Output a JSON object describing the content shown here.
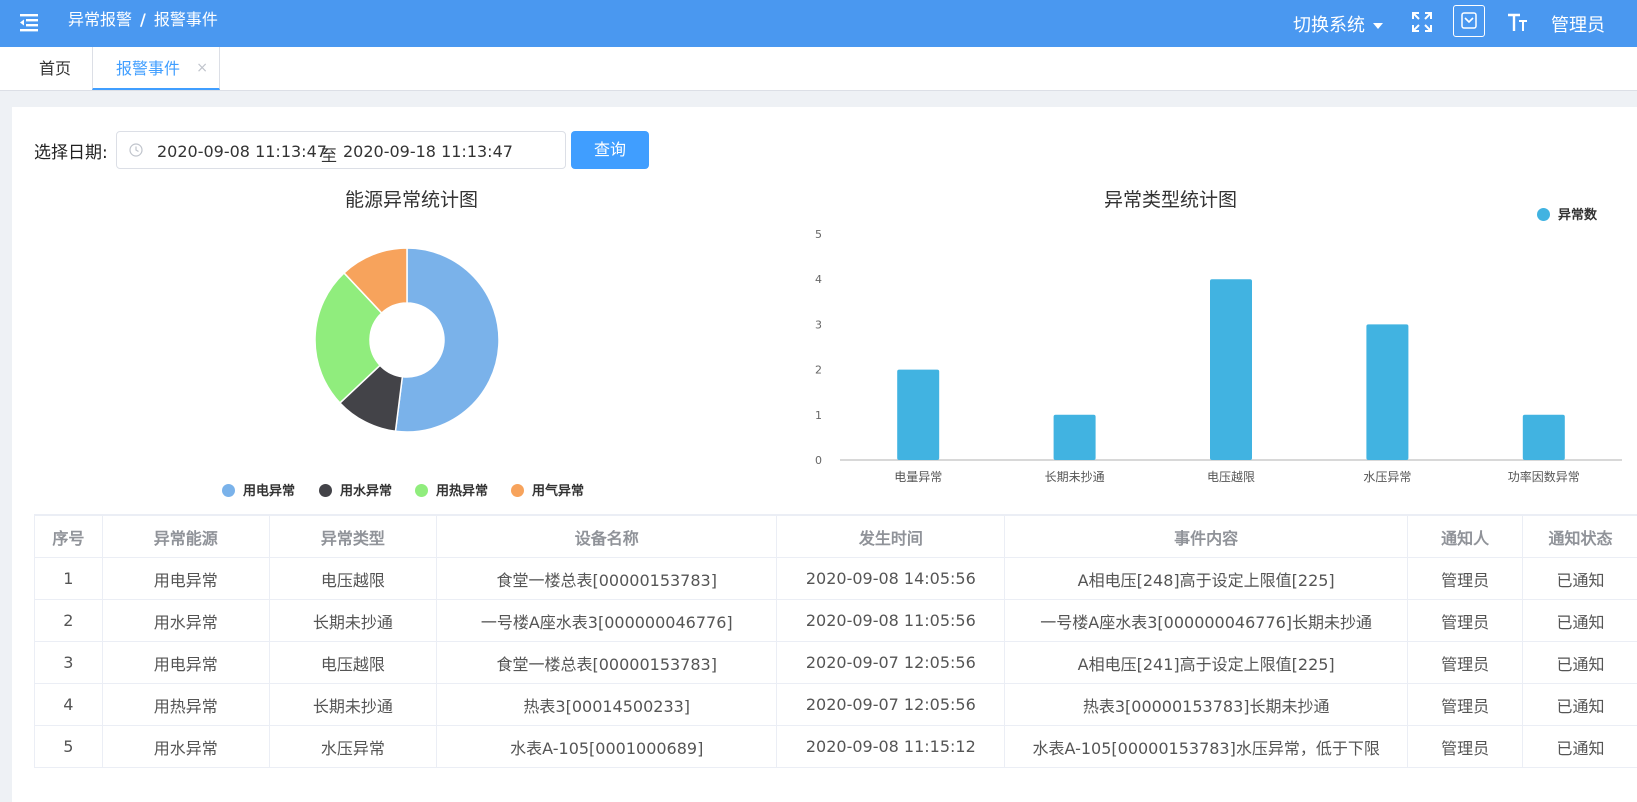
{
  "header": {
    "breadcrumb": [
      "异常报警",
      "报警事件"
    ],
    "breadcrumb_sep": "/",
    "system_switch": "切换系统",
    "user": "管理员"
  },
  "tabs": [
    {
      "label": "首页",
      "active": false
    },
    {
      "label": "报警事件",
      "active": true
    }
  ],
  "filter": {
    "date_label": "选择日期:",
    "start": "2020-09-08 11:13:47",
    "to": "至",
    "end": "2020-09-18 11:13:47",
    "query_label": "查询"
  },
  "chart_data": [
    {
      "type": "pie",
      "title": "能源异常统计图",
      "labels": [
        "用电异常",
        "用水异常",
        "用热异常",
        "用气异常"
      ],
      "values": [
        52,
        11,
        25,
        12
      ],
      "colors": [
        "#7ab2ea",
        "#434348",
        "#90ed7d",
        "#f7a35c"
      ]
    },
    {
      "type": "bar",
      "title": "异常类型统计图",
      "categories": [
        "电量异常",
        "长期未抄通",
        "电压越限",
        "水压异常",
        "功率因数异常"
      ],
      "series": [
        {
          "name": "异常数",
          "values": [
            2,
            1,
            4,
            3,
            1
          ],
          "color": "#41b3e1"
        }
      ],
      "ylim": [
        0,
        5
      ],
      "yticks": [
        "0",
        "1",
        "2",
        "3",
        "4",
        "5"
      ],
      "legend": "top-right"
    }
  ],
  "table": {
    "columns": [
      "序号",
      "异常能源",
      "异常类型",
      "设备名称",
      "发生时间",
      "事件内容",
      "通知人",
      "通知状态"
    ],
    "rows": [
      [
        "1",
        "用电异常",
        "电压越限",
        "食堂一楼总表[00000153783]",
        "2020-09-08 14:05:56",
        "A相电压[248]高于设定上限值[225]",
        "管理员",
        "已通知"
      ],
      [
        "2",
        "用水异常",
        "长期未抄通",
        "一号楼A座水表3[000000046776]",
        "2020-09-08 11:05:56",
        "一号楼A座水表3[000000046776]长期未抄通",
        "管理员",
        "已通知"
      ],
      [
        "3",
        "用电异常",
        "电压越限",
        "食堂一楼总表[00000153783]",
        "2020-09-07 12:05:56",
        "A相电压[241]高于设定上限值[225]",
        "管理员",
        "已通知"
      ],
      [
        "4",
        "用热异常",
        "长期未抄通",
        "热表3[00014500233]",
        "2020-09-07 12:05:56",
        "热表3[00000153783]长期未抄通",
        "管理员",
        "已通知"
      ],
      [
        "5",
        "用水异常",
        "水压异常",
        "水表A-105[0001000689]",
        "2020-09-08 11:15:12",
        "水表A-105[00000153783]水压异常，低于下限",
        "管理员",
        "已通知"
      ]
    ]
  }
}
